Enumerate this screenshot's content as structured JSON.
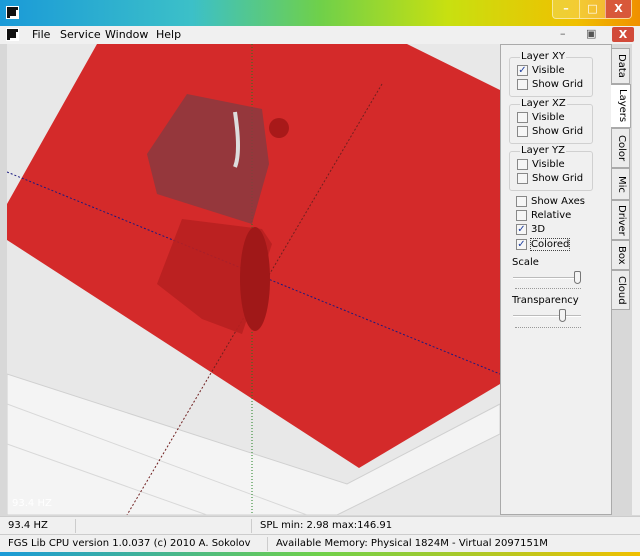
{
  "window": {
    "minimize": "–",
    "maximize": "□",
    "close": "X"
  },
  "menu": [
    "File",
    "Service",
    "Window",
    "Help"
  ],
  "mdi": {
    "minimize": "–",
    "restore": "▣",
    "close": "X"
  },
  "viewport": {
    "fps_overlay": "93.4 HZ",
    "plane_color": "#d42a2a"
  },
  "panel": {
    "groups": [
      {
        "title": "Layer XY",
        "items": [
          {
            "label": "Visible",
            "checked": true
          },
          {
            "label": "Show Grid",
            "checked": false
          }
        ]
      },
      {
        "title": "Layer XZ",
        "items": [
          {
            "label": "Visible",
            "checked": false
          },
          {
            "label": "Show Grid",
            "checked": false
          }
        ]
      },
      {
        "title": "Layer YZ",
        "items": [
          {
            "label": "Visible",
            "checked": false
          },
          {
            "label": "Show Grid",
            "checked": false
          }
        ]
      }
    ],
    "options": [
      {
        "label": "Show Axes",
        "checked": false
      },
      {
        "label": "Relative",
        "checked": false
      },
      {
        "label": "3D",
        "checked": true
      },
      {
        "label": "Colored",
        "checked": true
      }
    ],
    "scale_label": "Scale",
    "scale_value": 1.0,
    "transparency_label": "Transparency",
    "transparency_value": 0.75
  },
  "tabs": [
    "Data",
    "Layers",
    "Color",
    "Mic",
    "Driver",
    "Box",
    "Cloud"
  ],
  "active_tab": "Layers",
  "status": {
    "fps": "93.4 HZ",
    "spl": "SPL min: 2.98 max:146.91",
    "version": "FGS Lib CPU version 1.0.037 (c) 2010 A. Sokolov",
    "memory": "Available Memory: Physical 1824M - Virtual 2097151M"
  }
}
